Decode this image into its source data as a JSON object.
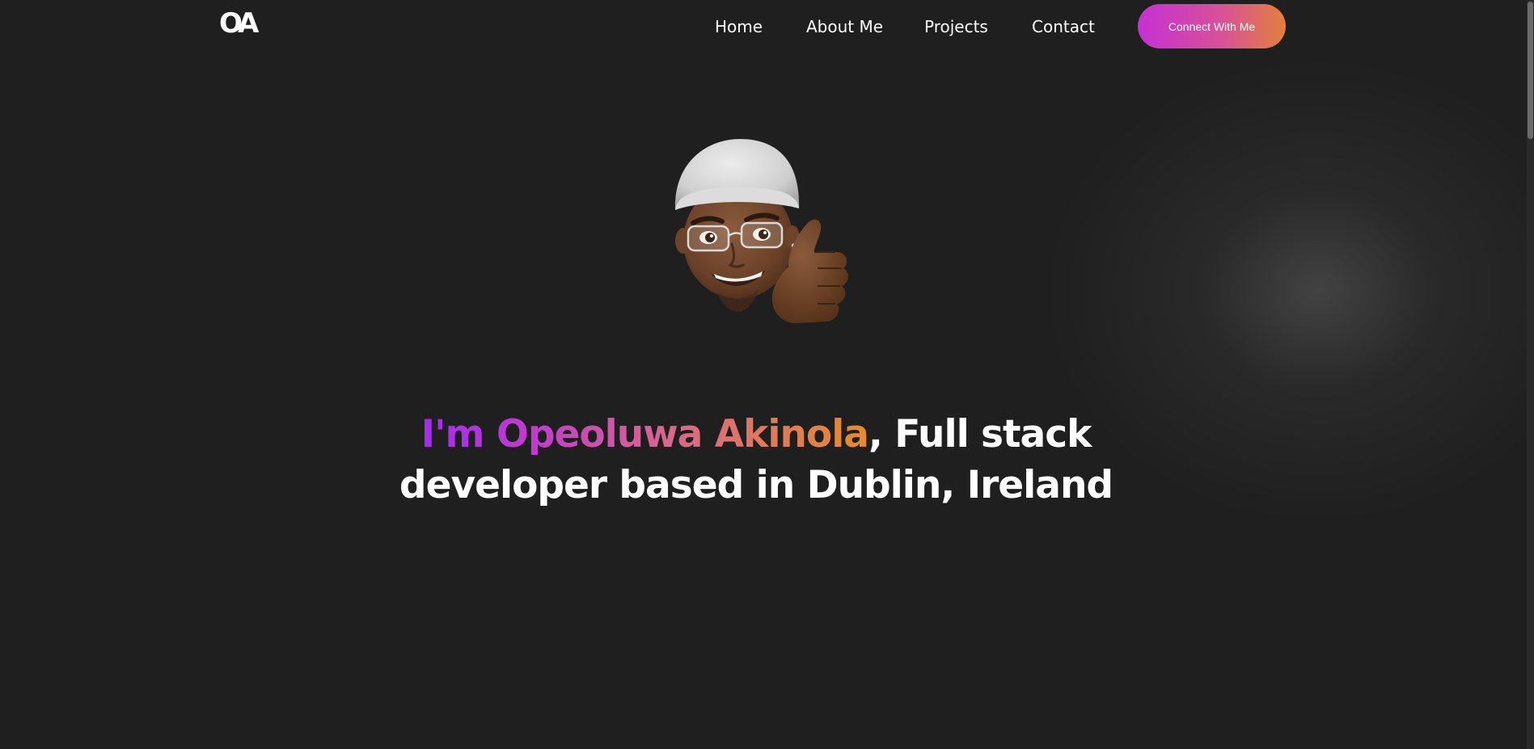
{
  "nav": {
    "logo": "OA",
    "links": [
      "Home",
      "About Me",
      "Projects",
      "Contact"
    ],
    "cta_label": "Connect With Me"
  },
  "hero": {
    "avatar_icon": "memoji-thumbs-up-icon",
    "headline_highlight": "I'm Opeoluwa Akinola",
    "headline_rest": ", Full stack developer based in Dublin, Ireland"
  },
  "colors": {
    "background": "#1f1f1f",
    "gradient_start": "#a22bf0",
    "gradient_end": "#e58b2c",
    "text": "#ffffff"
  }
}
